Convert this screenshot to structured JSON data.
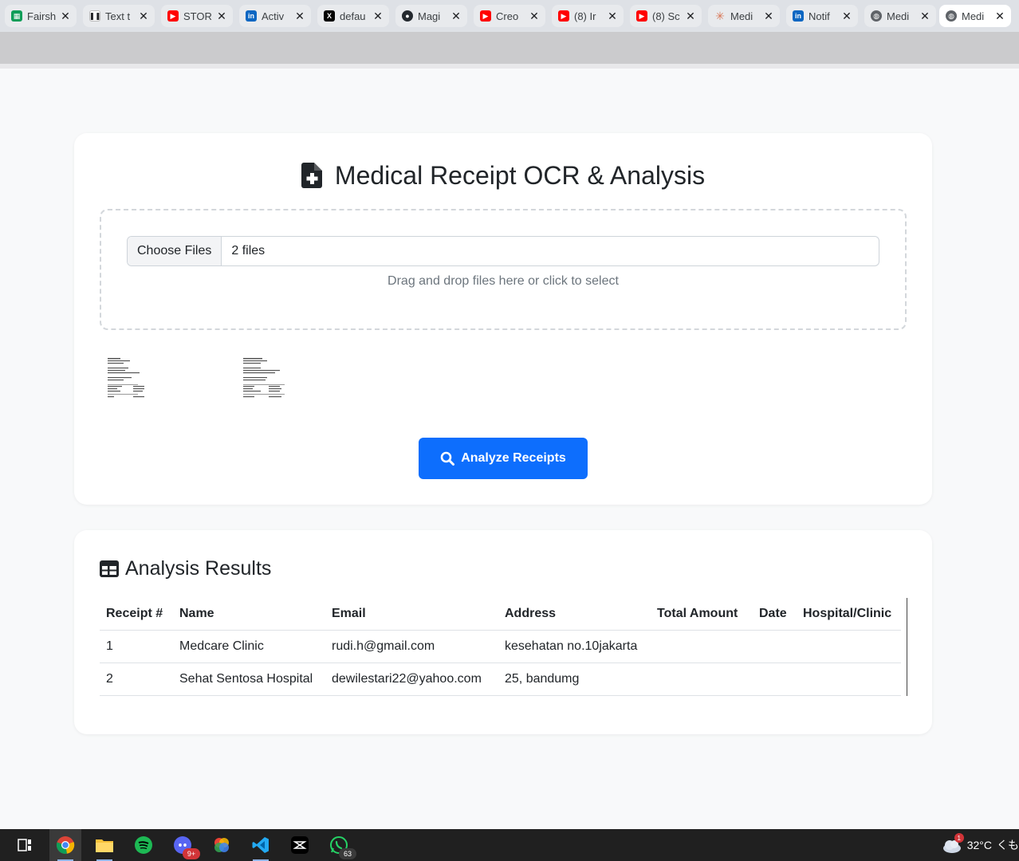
{
  "browser": {
    "tabs": [
      {
        "title": "Fairsh",
        "icon": "sheets-icon",
        "color": "#0f9d58"
      },
      {
        "title": "Text t",
        "icon": "pause-icon",
        "color": "#ffffff"
      },
      {
        "title": "STOR",
        "icon": "youtube-icon",
        "color": "#ff0000"
      },
      {
        "title": "Activ",
        "icon": "linkedin-icon",
        "color": "#0a66c2"
      },
      {
        "title": "defau",
        "icon": "x-icon",
        "color": "#000000"
      },
      {
        "title": "Magi",
        "icon": "github-icon",
        "color": "#24292f"
      },
      {
        "title": "Creo",
        "icon": "youtube-icon",
        "color": "#ff0000"
      },
      {
        "title": "(8) Ir",
        "icon": "youtube-icon",
        "color": "#ff0000"
      },
      {
        "title": "(8) Sc",
        "icon": "youtube-icon",
        "color": "#ff0000"
      },
      {
        "title": "Medi",
        "icon": "claude-icon",
        "color": "#d97757"
      },
      {
        "title": "Notif",
        "icon": "linkedin-icon",
        "color": "#0a66c2"
      },
      {
        "title": "Medi",
        "icon": "globe-icon",
        "color": "#5f6368"
      },
      {
        "title": "Medi",
        "icon": "globe-icon",
        "color": "#5f6368",
        "active": true
      }
    ]
  },
  "upload": {
    "title": "Medical Receipt OCR & Analysis",
    "choose_files_label": "Choose Files",
    "file_count": "2 files",
    "drop_hint": "Drag and drop files here or click to select",
    "analyze_label": "Analyze Receipts"
  },
  "results": {
    "title": "Analysis Results",
    "columns": [
      "Receipt #",
      "Name",
      "Email",
      "Address",
      "Total Amount",
      "Date",
      "Hospital/Clinic"
    ],
    "rows": [
      [
        "1",
        "Medcare Clinic",
        "rudi.h@gmail.com",
        "kesehatan no.10jakarta",
        "",
        "",
        ""
      ],
      [
        "2",
        "Sehat Sentosa Hospital",
        "dewilestari22@yahoo.com",
        "25, bandumg",
        "",
        "",
        ""
      ]
    ]
  },
  "taskbar": {
    "discord_badge": "9+",
    "whatsapp_badge": "63",
    "weather_alert": "1",
    "temperature": "32°C",
    "weather_text": "くも"
  },
  "colors": {
    "primary": "#0d6efd",
    "background": "#f8f9fa",
    "muted_text": "#6c757d"
  }
}
